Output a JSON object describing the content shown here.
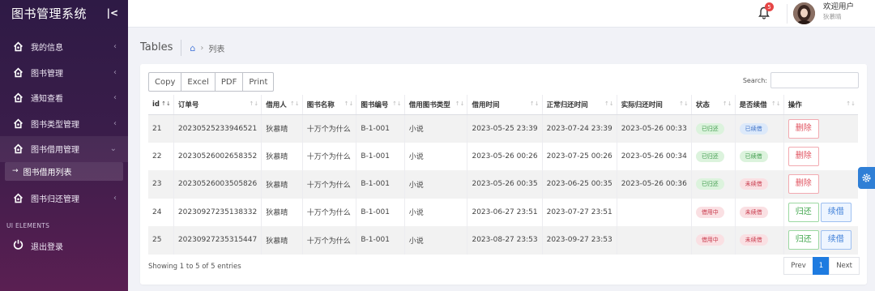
{
  "app": {
    "title": "图书管理系统"
  },
  "sidebar": {
    "items": [
      {
        "label": "我的信息"
      },
      {
        "label": "图书管理"
      },
      {
        "label": "通知查看"
      },
      {
        "label": "图书类型管理"
      },
      {
        "label": "图书借用管理"
      },
      {
        "label": "图书归还管理"
      }
    ],
    "active_sub": "图书借用列表",
    "section_label": "UI ELEMENTS",
    "logout": "退出登录"
  },
  "header": {
    "notification_count": "5",
    "welcome": "欢迎用户",
    "username": "狄慕晴"
  },
  "breadcrumb": {
    "page_title": "Tables",
    "current": "列表"
  },
  "toolbar": {
    "copy": "Copy",
    "excel": "Excel",
    "pdf": "PDF",
    "print": "Print",
    "search_label": "Search:"
  },
  "table": {
    "columns": [
      "id",
      "订单号",
      "借用人",
      "图书名称",
      "图书编号",
      "借用图书类型",
      "借用时间",
      "正常归还时间",
      "实际归还时间",
      "状态",
      "是否续借",
      "操作"
    ],
    "rows": [
      {
        "id": "21",
        "order": "20230525233946521",
        "borrower": "狄慕晴",
        "book": "十万个为什么",
        "code": "B-1-001",
        "type": "小说",
        "borrow_time": "2023-05-25 23:39",
        "due_time": "2023-07-24 23:39",
        "actual_time": "2023-05-26 00:33",
        "status": "已归还",
        "renew": "已续借",
        "actions": [
          "删除"
        ]
      },
      {
        "id": "22",
        "order": "20230526002658352",
        "borrower": "狄慕晴",
        "book": "十万个为什么",
        "code": "B-1-001",
        "type": "小说",
        "borrow_time": "2023-05-26 00:26",
        "due_time": "2023-07-25 00:26",
        "actual_time": "2023-05-26 00:34",
        "status": "已归还",
        "renew": "已续借",
        "actions": [
          "删除"
        ]
      },
      {
        "id": "23",
        "order": "20230526003505826",
        "borrower": "狄慕晴",
        "book": "十万个为什么",
        "code": "B-1-001",
        "type": "小说",
        "borrow_time": "2023-05-26 00:35",
        "due_time": "2023-06-25 00:35",
        "actual_time": "2023-05-26 00:36",
        "status": "已归还",
        "renew": "未续借",
        "actions": [
          "删除"
        ]
      },
      {
        "id": "24",
        "order": "20230927235138332",
        "borrower": "狄慕晴",
        "book": "十万个为什么",
        "code": "B-1-001",
        "type": "小说",
        "borrow_time": "2023-06-27 23:51",
        "due_time": "2023-07-27 23:51",
        "actual_time": "",
        "status": "借用中",
        "renew": "未续借",
        "actions": [
          "归还",
          "续借"
        ]
      },
      {
        "id": "25",
        "order": "20230927235315447",
        "borrower": "狄慕晴",
        "book": "十万个为什么",
        "code": "B-1-001",
        "type": "小说",
        "borrow_time": "2023-08-27 23:53",
        "due_time": "2023-09-27 23:53",
        "actual_time": "",
        "status": "借用中",
        "renew": "未续借",
        "actions": [
          "归还",
          "续借"
        ]
      }
    ]
  },
  "footer": {
    "info": "Showing 1 to 5 of 5 entries",
    "prev": "Prev",
    "page": "1",
    "next": "Next"
  },
  "colors": {
    "accent": "#1e7be0",
    "sidebar_top": "#2e1a45",
    "sidebar_bottom": "#5a1f52",
    "returned": "#3d9a4a",
    "renewed": "#3f73c8",
    "not_renewed": "#c83a4c"
  }
}
